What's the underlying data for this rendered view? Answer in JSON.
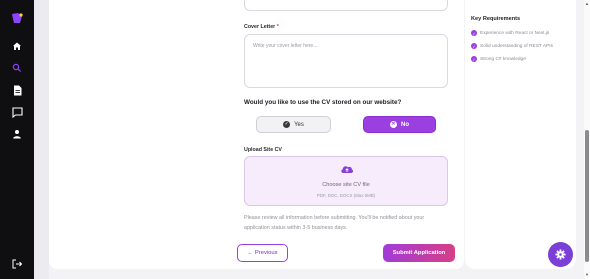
{
  "sidebar": {
    "icons": [
      "logo-icon",
      "home-icon",
      "search-icon",
      "document-icon",
      "chat-icon",
      "user-icon",
      "logout-icon"
    ]
  },
  "form": {
    "cover_letter_label": "Cover Letter",
    "required_mark": "*",
    "cover_letter_placeholder": "Write your cover letter here...",
    "question": "Would you like to use the CV stored on our website?",
    "option_yes": "Yes",
    "option_no": "No",
    "selected_option": "No",
    "upload_label": "Upload Site CV",
    "upload_title": "Choose site CV file",
    "upload_formats": "PDF, DOC, DOCX (Max 5MB)",
    "note": "Please review all information before submitting. You'll be notified about your application status within 3-5 business days.",
    "previous_button": "← Previous",
    "submit_button": "Submit Application"
  },
  "requirements": {
    "title": "Key Requirements",
    "items": [
      "Experience with React or Next.js",
      "Solid understanding of REST APIs",
      "Strong C# knowledge"
    ]
  },
  "colors": {
    "sidebar_bg": "#0f0f12",
    "accent": "#9b3fe0",
    "submit_gradient_end": "#d63f86",
    "fab": "#7b3fd6"
  }
}
